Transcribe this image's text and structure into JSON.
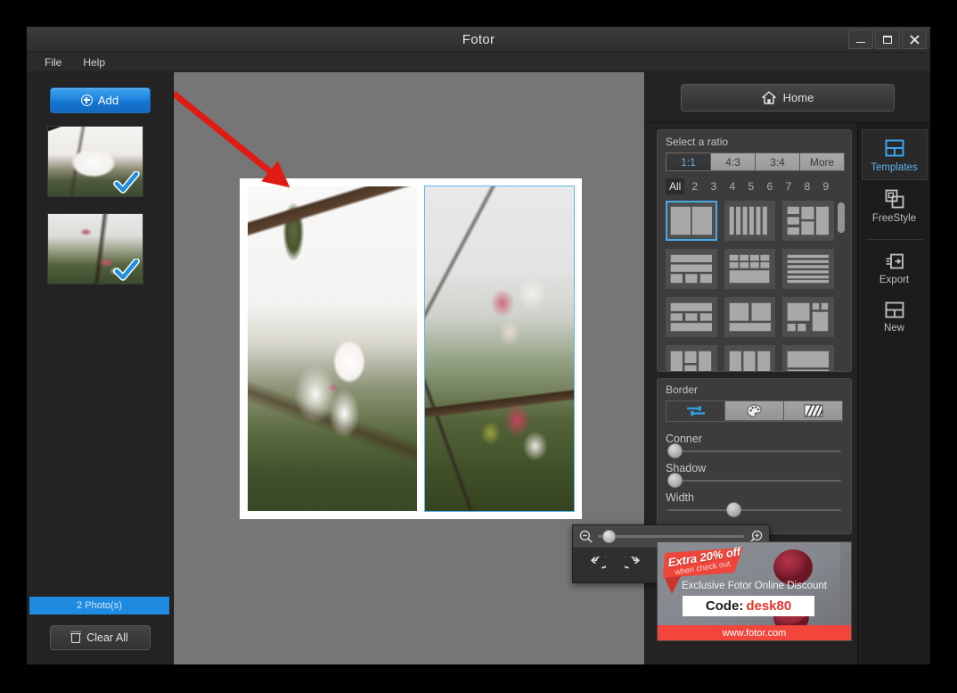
{
  "window": {
    "title": "Fotor",
    "controls": [
      {
        "name": "minimize-button",
        "label": "–"
      },
      {
        "name": "maximize-button",
        "label": "☐"
      },
      {
        "name": "close-button",
        "label": "✕"
      }
    ]
  },
  "menubar": {
    "items": [
      {
        "label": "File"
      },
      {
        "label": "Help"
      }
    ]
  },
  "left_panel": {
    "add_label": "Add",
    "add_icon": "plus-circle-icon",
    "photo_count_label": "2 Photo(s)",
    "clear_all_label": "Clear All",
    "clear_all_icon": "trash-icon",
    "thumbnails": [
      {
        "name": "photo-thumbnail-1",
        "selected": true,
        "check_icon": "blue-checkmark-icon"
      },
      {
        "name": "photo-thumbnail-2",
        "selected": true,
        "check_icon": "blue-checkmark-icon"
      }
    ]
  },
  "canvas": {
    "cells": [
      {
        "name": "collage-cell-left",
        "selected": false
      },
      {
        "name": "collage-cell-right",
        "selected": true
      }
    ],
    "annotation": {
      "name": "red-arrow-annotation",
      "type": "arrow",
      "color": "#e01b14"
    },
    "toolbar": {
      "zoom_out_icon": "magnifier-minus-icon",
      "zoom_in_icon": "magnifier-plus-icon",
      "zoom_value": 8,
      "buttons": [
        {
          "name": "rotate-left-button",
          "icon": "rotate-counterclockwise-icon"
        },
        {
          "name": "rotate-right-button",
          "icon": "rotate-clockwise-icon"
        },
        {
          "name": "flip-horizontal-button",
          "icon": "flip-horizontal-icon"
        },
        {
          "name": "flip-vertical-button",
          "icon": "flip-vertical-icon"
        },
        {
          "name": "delete-photo-button",
          "icon": "trash-icon"
        }
      ]
    }
  },
  "right_panel": {
    "home_label": "Home",
    "home_icon": "home-icon",
    "templates": {
      "ratio_title": "Select a ratio",
      "ratios": [
        {
          "label": "1:1",
          "active": true
        },
        {
          "label": "4:3",
          "active": false
        },
        {
          "label": "3:4",
          "active": false
        },
        {
          "label": "More",
          "active": false
        }
      ],
      "counts": [
        {
          "label": "All",
          "active": true
        },
        {
          "label": "2",
          "active": false
        },
        {
          "label": "3",
          "active": false
        },
        {
          "label": "4",
          "active": false
        },
        {
          "label": "5",
          "active": false
        },
        {
          "label": "6",
          "active": false
        },
        {
          "label": "7",
          "active": false
        },
        {
          "label": "8",
          "active": false
        },
        {
          "label": "9",
          "active": false
        }
      ],
      "items": [
        {
          "name": "template-2-vertical-split",
          "selected": true
        },
        {
          "name": "template-6-columns",
          "selected": false
        },
        {
          "name": "template-mixed-grid",
          "selected": false
        },
        {
          "name": "template-2-rows-3-cells",
          "selected": false
        },
        {
          "name": "template-8-top-1-bottom",
          "selected": false
        },
        {
          "name": "template-6-stripes",
          "selected": false
        },
        {
          "name": "template-banner-3-banner",
          "selected": false
        },
        {
          "name": "template-2-cells-banner",
          "selected": false
        },
        {
          "name": "template-large-with-smalls",
          "selected": false
        },
        {
          "name": "template-left-stack",
          "selected": false
        },
        {
          "name": "template-three-columns",
          "selected": false
        },
        {
          "name": "template-stacked-bars",
          "selected": false
        }
      ]
    },
    "border": {
      "title": "Border",
      "tabs": [
        {
          "name": "border-adjust-tab",
          "icon": "sliders-icon",
          "active": true
        },
        {
          "name": "border-color-tab",
          "icon": "palette-icon",
          "active": false
        },
        {
          "name": "border-pattern-tab",
          "icon": "pattern-icon",
          "active": false
        }
      ],
      "sliders": [
        {
          "label": "Conner",
          "value": 0
        },
        {
          "label": "Shadow",
          "value": 0
        },
        {
          "label": "Width",
          "value": 36
        }
      ]
    },
    "ad": {
      "badge_line1": "Extra 20% off",
      "badge_line2": "when check out",
      "headline": "Exclusive Fotor Online Discount",
      "code_label": "Code:",
      "code_value": "desk80",
      "url": "www.fotor.com"
    },
    "rail": [
      {
        "name": "rail-item-templates",
        "label": "Templates",
        "icon": "templates-grid-icon",
        "active": true
      },
      {
        "name": "rail-item-freestyle",
        "label": "FreeStyle",
        "icon": "freestyle-layers-icon",
        "active": false
      },
      {
        "name": "rail-item-export",
        "label": "Export",
        "icon": "export-arrow-icon",
        "active": false
      },
      {
        "name": "rail-item-new",
        "label": "New",
        "icon": "new-layout-icon",
        "active": false
      }
    ]
  },
  "colors": {
    "accent_blue": "#1e8ae0",
    "selection_blue": "#5fb6ee",
    "annotation_red": "#e01b14",
    "panel_bg": "#232323",
    "canvas_bg": "#767676"
  }
}
